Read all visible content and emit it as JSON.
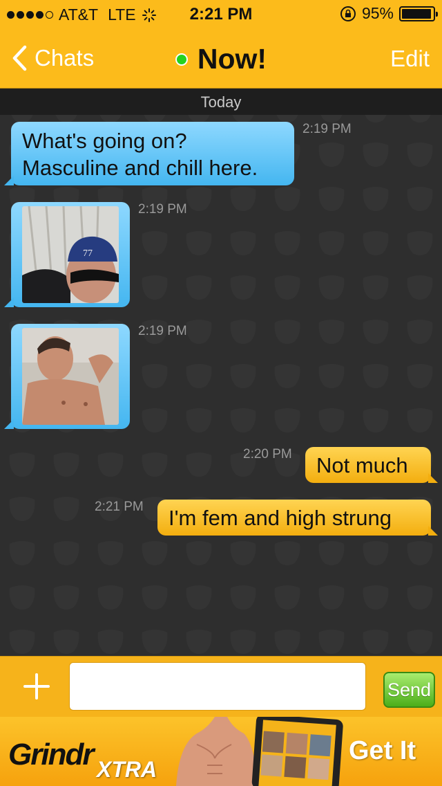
{
  "status_bar": {
    "carrier": "AT&T",
    "network": "LTE",
    "time": "2:21 PM",
    "battery": "95%",
    "battery_level": 0.95
  },
  "nav": {
    "back_label": "Chats",
    "title": "Now!",
    "edit_label": "Edit"
  },
  "chat": {
    "date_separator": "Today",
    "messages": [
      {
        "sender": "other",
        "type": "text",
        "line1": "What's going on?",
        "line2": "Masculine and chill here.",
        "time": "2:19 PM"
      },
      {
        "sender": "other",
        "type": "photo",
        "time": "2:19 PM"
      },
      {
        "sender": "other",
        "type": "photo",
        "time": "2:19 PM"
      },
      {
        "sender": "me",
        "type": "text",
        "text": "Not much",
        "time": "2:20 PM"
      },
      {
        "sender": "me",
        "type": "text",
        "text": "I'm fem and high strung",
        "time": "2:21 PM"
      }
    ]
  },
  "input": {
    "placeholder": "",
    "send_label": "Send"
  },
  "ad": {
    "brand": "Grindr",
    "sub": "XTRA",
    "cta": "Get It"
  },
  "colors": {
    "accent": "#fcbb1b",
    "incoming_bubble": "#44b6f0",
    "outgoing_bubble": "#f3ae0f",
    "online": "#23d21f",
    "send": "#4cae1a"
  }
}
